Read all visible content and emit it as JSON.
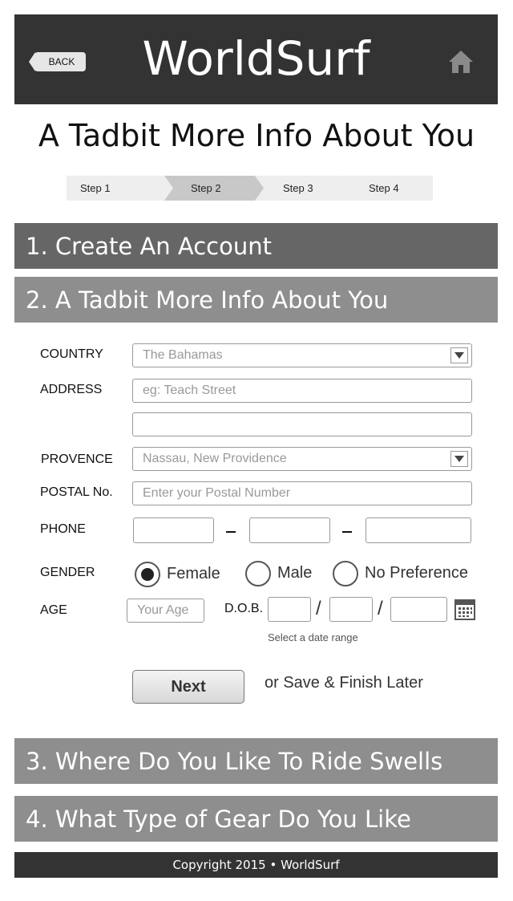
{
  "header": {
    "back_label": "BACK",
    "brand": "WorldSurf",
    "home_icon": "home-icon"
  },
  "page_title": "A Tadbit More Info About You",
  "steps": [
    {
      "label": "Step 1",
      "active": false
    },
    {
      "label": "Step 2",
      "active": true
    },
    {
      "label": "Step 3",
      "active": false
    },
    {
      "label": "Step 4",
      "active": false
    }
  ],
  "sections": {
    "s1": "1. Create An Account",
    "s2": "2. A Tadbit More Info About You",
    "s3": "3. Where Do You Like To Ride Swells",
    "s4": "4. What Type of Gear Do You Like"
  },
  "form": {
    "country_label": "COUNTRY",
    "country_value": "The Bahamas",
    "address_label": "ADDRESS",
    "address_placeholder": "eg: Teach Street",
    "address2_value": "",
    "province_label": "PROVENCE",
    "province_value": "Nassau, New Providence",
    "postal_label": "POSTAL No.",
    "postal_placeholder": "Enter your Postal Number",
    "phone_label": "PHONE",
    "phone_values": [
      "",
      "",
      ""
    ],
    "gender_label": "GENDER",
    "gender_options": [
      "Female",
      "Male",
      "No Preference"
    ],
    "gender_selected": "Female",
    "age_label": "AGE",
    "age_placeholder": "Your Age",
    "dob_label": "D.O.B.",
    "dob_separator": "/",
    "dob_hint": "Select a date range",
    "calendar_icon": "calendar-icon",
    "dropdown_icon": "chevron-down-icon"
  },
  "actions": {
    "next_label": "Next",
    "save_label": "or Save & Finish Later"
  },
  "footer": "Copyright 2015 • WorldSurf"
}
